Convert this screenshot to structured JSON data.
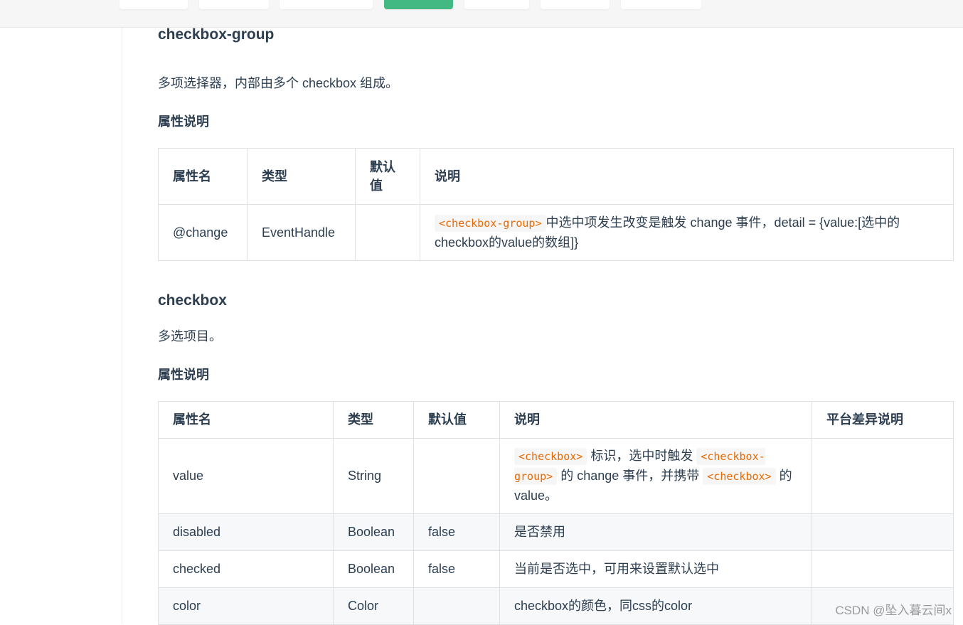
{
  "section1": {
    "title": "checkbox-group",
    "description": "多项选择器，内部由多个 checkbox 组成。",
    "props_heading": "属性说明",
    "table": {
      "headers": [
        "属性名",
        "类型",
        "默认\n值",
        "说明"
      ],
      "rows": [
        {
          "name": "@change",
          "type": "EventHandle",
          "default": "",
          "desc_code": "<checkbox-group>",
          "desc_text": "中选中项发生改变是触发 change 事件，detail = {value:[选中的checkbox的value的数组]}"
        }
      ]
    }
  },
  "section2": {
    "title": "checkbox",
    "description": "多选项目。",
    "props_heading": "属性说明",
    "table": {
      "headers": [
        "属性名",
        "类型",
        "默认值",
        "说明",
        "平台差异说明"
      ],
      "rows": [
        {
          "name": "value",
          "type": "String",
          "default": "",
          "desc_code1": "<checkbox>",
          "desc_text1": "标识，选中时触发",
          "desc_code2": "<checkbox-group>",
          "desc_text2": "的 change 事件，并携带",
          "desc_code3": "<checkbox>",
          "desc_text3": "的 value。",
          "platform": ""
        },
        {
          "name": "disabled",
          "type": "Boolean",
          "default": "false",
          "desc": "是否禁用",
          "platform": ""
        },
        {
          "name": "checked",
          "type": "Boolean",
          "default": "false",
          "desc": "当前是否选中，可用来设置默认选中",
          "platform": ""
        },
        {
          "name": "color",
          "type": "Color",
          "default": "",
          "desc": "checkbox的颜色，同css的color",
          "platform": ""
        }
      ]
    }
  },
  "watermark": "CSDN @坠入暮云间x",
  "colors": {
    "accent": "#42b983",
    "code": "#e96900",
    "text": "#2c3e50",
    "border": "#dfe2e5"
  }
}
